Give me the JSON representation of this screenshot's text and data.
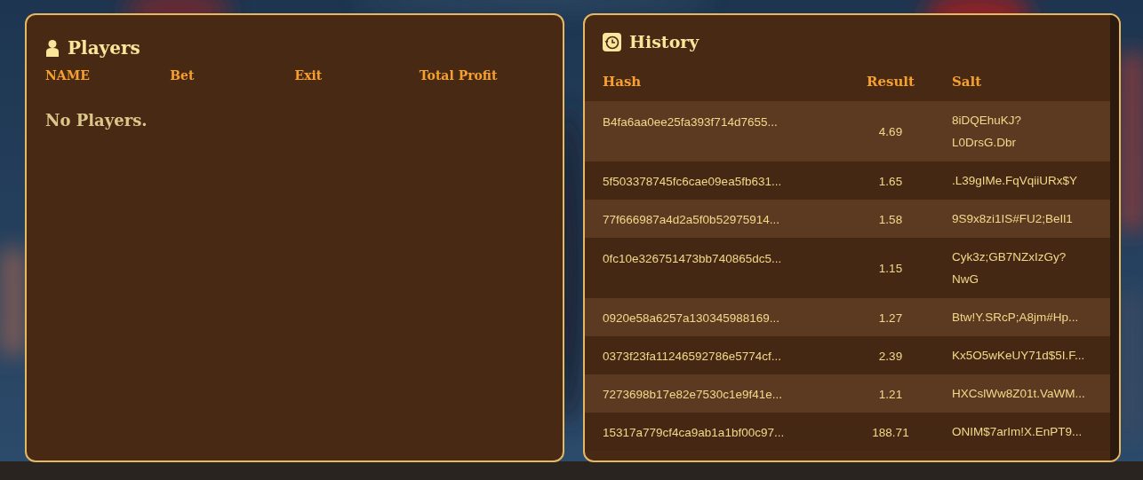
{
  "players": {
    "title": "Players",
    "columns": [
      "NAME",
      "Bet",
      "Exit",
      "Total Profit"
    ],
    "empty_message": "No Players."
  },
  "history": {
    "title": "History",
    "columns": [
      "Hash",
      "Result",
      "Salt"
    ],
    "rows": [
      {
        "hash": "B4fa6aa0ee25fa393f714d7655...",
        "result": "4.69",
        "salt": [
          "8iDQEhuKJ?",
          "L0DrsG.Dbr"
        ]
      },
      {
        "hash": "5f503378745fc6cae09ea5fb631...",
        "result": "1.65",
        "salt": [
          ".L39gIMe.FqVqiiURx$Y"
        ]
      },
      {
        "hash": "77f666987a4d2a5f0b52975914...",
        "result": "1.58",
        "salt": [
          "9S9x8zi1IS#FU2;BeIl1"
        ]
      },
      {
        "hash": "0fc10e326751473bb740865dc5...",
        "result": "1.15",
        "salt": [
          "Cyk3z;GB7NZxIzGy?",
          "NwG"
        ]
      },
      {
        "hash": "0920e58a6257a130345988169...",
        "result": "1.27",
        "salt": [
          "Btw!Y.SRcP;A8jm#Hp..."
        ]
      },
      {
        "hash": "0373f23fa11246592786e5774cf...",
        "result": "2.39",
        "salt": [
          "Kx5O5wKeUY71d$5I.F..."
        ]
      },
      {
        "hash": "7273698b17e82e7530c1e9f41e...",
        "result": "1.21",
        "salt": [
          "HXCslWw8Z01t.VaWM..."
        ]
      },
      {
        "hash": "15317a779cf4ca9ab1a1bf00c97...",
        "result": "188.71",
        "salt": [
          "ONIM$7arIm!X.EnPT9..."
        ]
      }
    ]
  }
}
